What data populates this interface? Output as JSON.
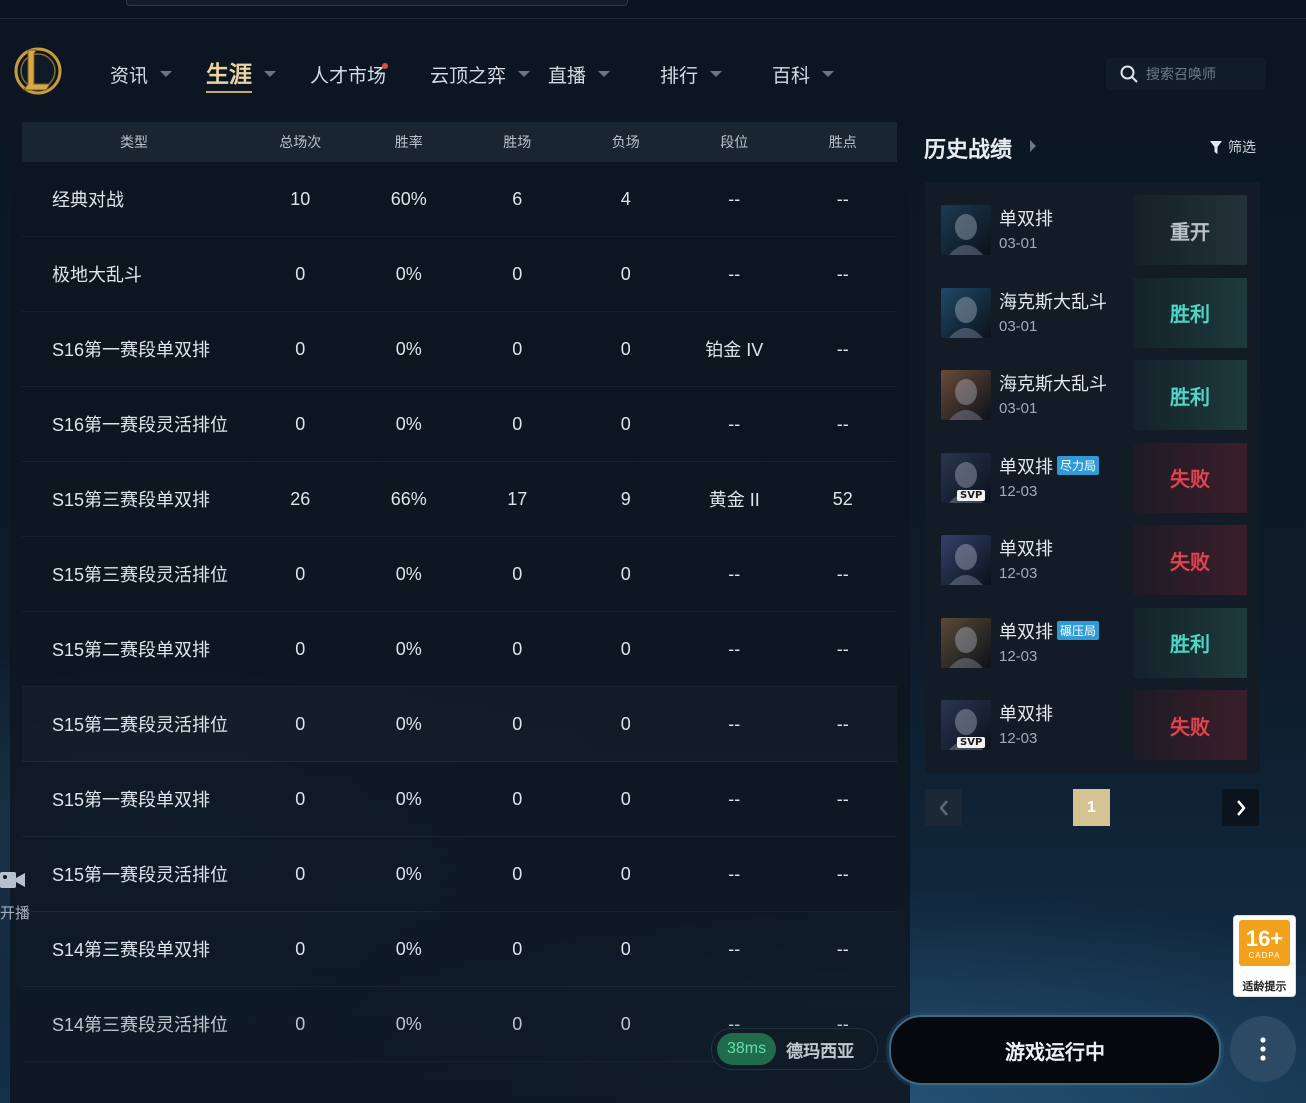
{
  "nav": {
    "items": [
      {
        "label": "资讯",
        "chevron": true,
        "dot": false,
        "active": false
      },
      {
        "label": "生涯",
        "chevron": true,
        "dot": false,
        "active": true
      },
      {
        "label": "人才市场",
        "chevron": false,
        "dot": true,
        "active": false
      },
      {
        "label": "云顶之弈",
        "chevron": true,
        "dot": false,
        "active": false
      },
      {
        "label": "直播",
        "chevron": true,
        "dot": false,
        "active": false
      },
      {
        "label": "排行",
        "chevron": true,
        "dot": false,
        "active": false
      },
      {
        "label": "百科",
        "chevron": true,
        "dot": false,
        "active": false
      }
    ],
    "search_placeholder": "搜索召唤师"
  },
  "table": {
    "headers": [
      "类型",
      "总场次",
      "胜率",
      "胜场",
      "负场",
      "段位",
      "胜点"
    ],
    "rows": [
      [
        "经典对战",
        "10",
        "60%",
        "6",
        "4",
        "--",
        "--"
      ],
      [
        "极地大乱斗",
        "0",
        "0%",
        "0",
        "0",
        "--",
        "--"
      ],
      [
        "S16第一赛段单双排",
        "0",
        "0%",
        "0",
        "0",
        "铂金 IV",
        "--"
      ],
      [
        "S16第一赛段灵活排位",
        "0",
        "0%",
        "0",
        "0",
        "--",
        "--"
      ],
      [
        "S15第三赛段单双排",
        "26",
        "66%",
        "17",
        "9",
        "黄金 II",
        "52"
      ],
      [
        "S15第三赛段灵活排位",
        "0",
        "0%",
        "0",
        "0",
        "--",
        "--"
      ],
      [
        "S15第二赛段单双排",
        "0",
        "0%",
        "0",
        "0",
        "--",
        "--"
      ],
      [
        "S15第二赛段灵活排位",
        "0",
        "0%",
        "0",
        "0",
        "--",
        "--"
      ],
      [
        "S15第一赛段单双排",
        "0",
        "0%",
        "0",
        "0",
        "--",
        "--"
      ],
      [
        "S15第一赛段灵活排位",
        "0",
        "0%",
        "0",
        "0",
        "--",
        "--"
      ],
      [
        "S14第三赛段单双排",
        "0",
        "0%",
        "0",
        "0",
        "--",
        "--"
      ],
      [
        "S14第三赛段灵活排位",
        "0",
        "0%",
        "0",
        "0",
        "--",
        "--"
      ]
    ]
  },
  "live": {
    "label": "开播"
  },
  "history": {
    "title": "历史战绩",
    "filter_label": "筛选",
    "matches": [
      {
        "mode": "单双排",
        "tag": "",
        "date": "03-01",
        "result": "重开",
        "kind": "remake",
        "svp": "",
        "avatar_color": "#1d3a52"
      },
      {
        "mode": "海克斯大乱斗",
        "tag": "",
        "date": "03-01",
        "result": "胜利",
        "kind": "win",
        "svp": "",
        "avatar_color": "#1f4a66"
      },
      {
        "mode": "海克斯大乱斗",
        "tag": "",
        "date": "03-01",
        "result": "胜利",
        "kind": "win",
        "svp": "",
        "avatar_color": "#6b4a3a"
      },
      {
        "mode": "单双排",
        "tag": "尽力局",
        "date": "12-03",
        "result": "失败",
        "kind": "lose",
        "svp": "SVP",
        "avatar_color": "#2a3552"
      },
      {
        "mode": "单双排",
        "tag": "",
        "date": "12-03",
        "result": "失败",
        "kind": "lose",
        "svp": "",
        "avatar_color": "#34406a"
      },
      {
        "mode": "单双排",
        "tag": "碾压局",
        "date": "12-03",
        "result": "胜利",
        "kind": "win",
        "svp": "",
        "avatar_color": "#5a4a36"
      },
      {
        "mode": "单双排",
        "tag": "",
        "date": "12-03",
        "result": "失败",
        "kind": "lose",
        "svp": "SVP",
        "avatar_color": "#2a3552"
      }
    ],
    "page": "1"
  },
  "rating": {
    "age": "16+",
    "org": "CADPA",
    "tip": "适龄提示"
  },
  "status": {
    "ping": "38ms",
    "server": "德玛西亚"
  },
  "play_button": "游戏运行中",
  "colors": {
    "accent_gold": "#c8a872",
    "win": "#4fd6c4",
    "lose": "#e2434e"
  }
}
